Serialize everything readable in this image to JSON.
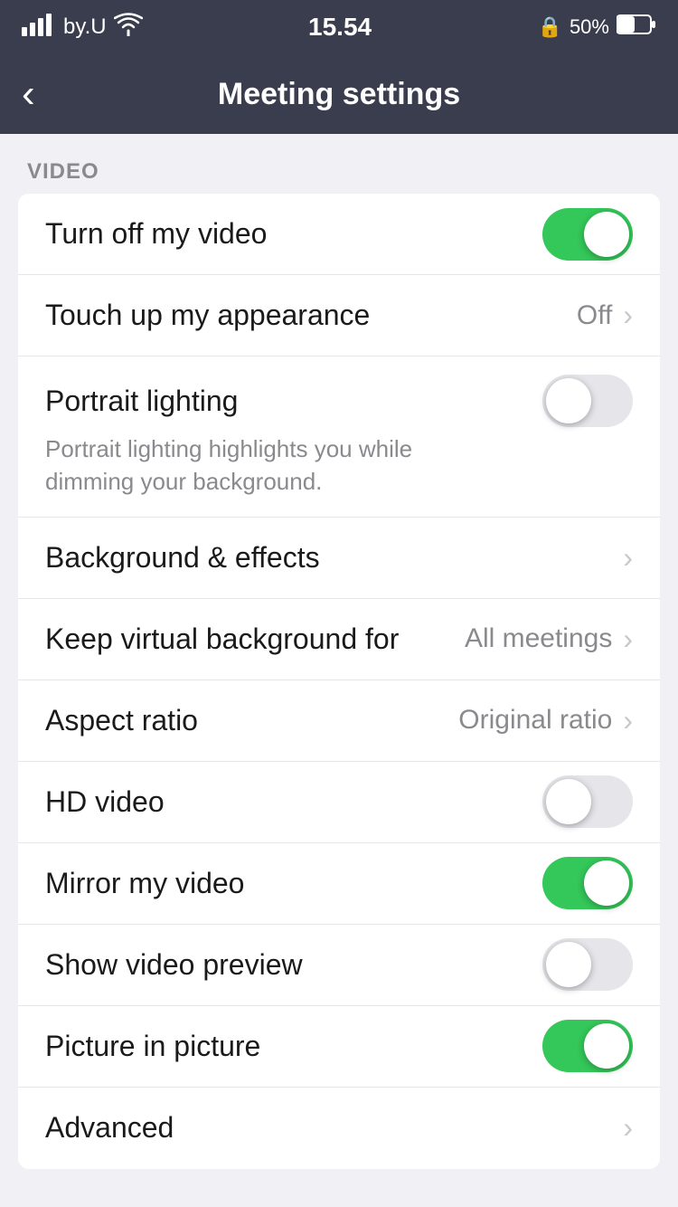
{
  "statusBar": {
    "carrier": "by.U",
    "time": "15.54",
    "battery": "50%",
    "lockIcon": "🔒"
  },
  "navBar": {
    "title": "Meeting settings",
    "backLabel": "‹"
  },
  "sections": [
    {
      "id": "video",
      "label": "VIDEO",
      "items": [
        {
          "id": "turn-off-video",
          "label": "Turn off my video",
          "type": "toggle",
          "value": "on",
          "hasDesc": false
        },
        {
          "id": "touch-up-appearance",
          "label": "Touch up my appearance",
          "type": "nav",
          "valueText": "Off",
          "hasDesc": false
        },
        {
          "id": "portrait-lighting",
          "label": "Portrait lighting",
          "type": "toggle",
          "value": "off",
          "hasDesc": true,
          "desc": "Portrait lighting highlights you while dimming your background."
        },
        {
          "id": "background-effects",
          "label": "Background & effects",
          "type": "nav",
          "valueText": "",
          "hasDesc": false
        },
        {
          "id": "keep-virtual-background",
          "label": "Keep virtual background for",
          "type": "nav",
          "valueText": "All meetings",
          "hasDesc": false
        },
        {
          "id": "aspect-ratio",
          "label": "Aspect ratio",
          "type": "nav",
          "valueText": "Original ratio",
          "hasDesc": false
        },
        {
          "id": "hd-video",
          "label": "HD video",
          "type": "toggle",
          "value": "off",
          "hasDesc": false
        },
        {
          "id": "mirror-video",
          "label": "Mirror my video",
          "type": "toggle",
          "value": "on",
          "hasDesc": false
        },
        {
          "id": "show-video-preview",
          "label": "Show video preview",
          "type": "toggle",
          "value": "off",
          "hasDesc": false
        },
        {
          "id": "picture-in-picture",
          "label": "Picture in picture",
          "type": "toggle",
          "value": "on",
          "hasDesc": false
        },
        {
          "id": "advanced",
          "label": "Advanced",
          "type": "nav",
          "valueText": "",
          "hasDesc": false
        }
      ]
    }
  ],
  "colors": {
    "toggleOn": "#34c759",
    "toggleOff": "#e5e5ea",
    "navBg": "#3a3d4e",
    "sectionBg": "#f0f0f5",
    "chevron": "#c7c7cc",
    "valueText": "#8a8a8e"
  }
}
